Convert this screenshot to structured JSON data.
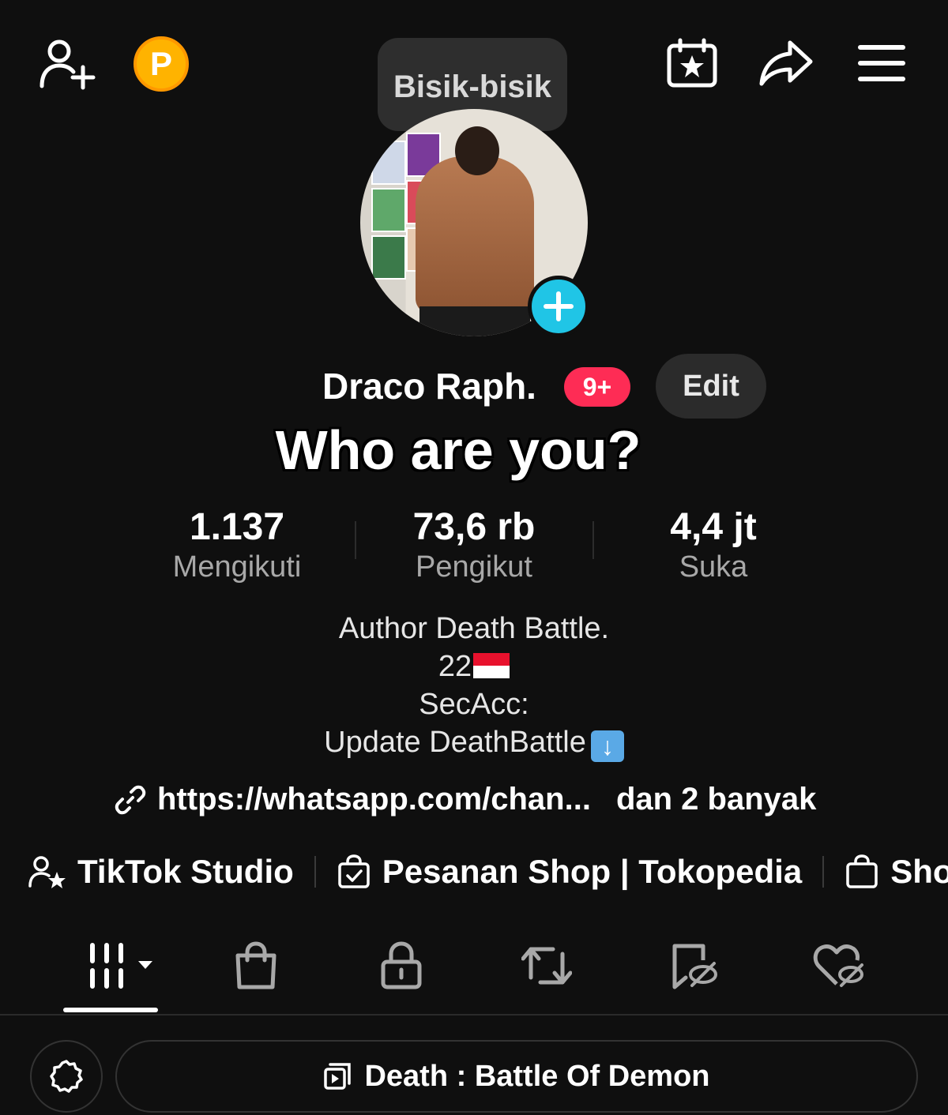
{
  "topbar": {
    "coin_letter": "P",
    "whisper_bubble": "Bisik-bisik"
  },
  "profile": {
    "name": "Draco Raph.",
    "notification_badge": "9+",
    "edit_label": "Edit",
    "overlay_caption": "Who are you?"
  },
  "stats": [
    {
      "value": "1.137",
      "label": "Mengikuti"
    },
    {
      "value": "73,6 rb",
      "label": "Pengikut"
    },
    {
      "value": "4,4 jt",
      "label": "Suka"
    }
  ],
  "bio": {
    "line1": "Author Death Battle.",
    "line2": "22",
    "line3": "SecAcc:",
    "line4": "Update DeathBattle"
  },
  "link": {
    "url": "https://whatsapp.com/chan...",
    "more": "dan 2 banyak"
  },
  "shortcuts": [
    {
      "label": "TikTok Studio",
      "icon": "person-star-icon"
    },
    {
      "label": "Pesanan Shop | Tokopedia",
      "icon": "shopping-bag-check-icon"
    },
    {
      "label": "Sho",
      "icon": "shopping-bag-icon"
    }
  ],
  "tabs": [
    "videos",
    "shop",
    "private",
    "reposts",
    "favorites",
    "liked"
  ],
  "bottom": {
    "playlist_label": "Death : Battle Of Demon"
  },
  "colors": {
    "background": "#0f0f0f",
    "accent_red": "#fe2c55",
    "accent_cyan": "#20c5e6",
    "coin": "#ffb300"
  }
}
